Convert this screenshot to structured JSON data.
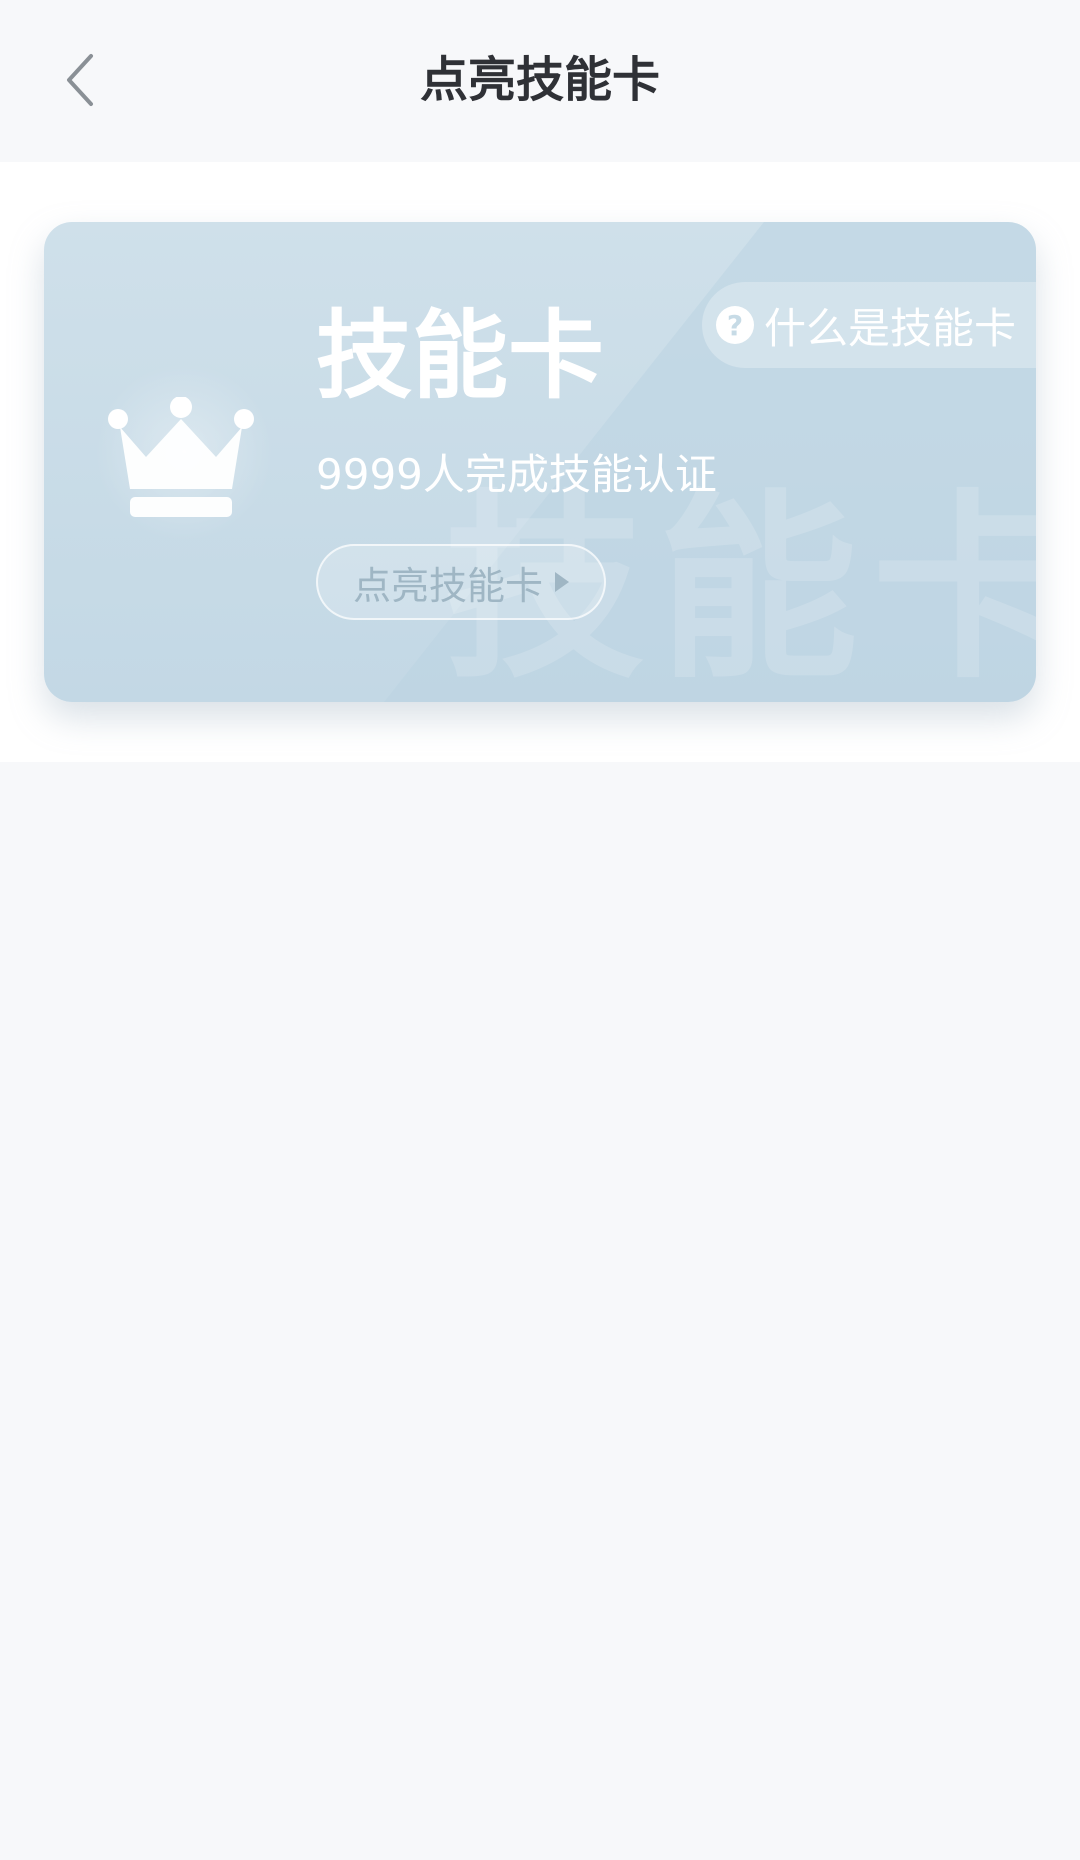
{
  "header": {
    "title": "点亮技能卡"
  },
  "card": {
    "title": "技能卡",
    "subtitle": "9999人完成技能认证",
    "watermark": "技能卡",
    "light_button_label": "点亮技能卡",
    "help_label": "什么是技能卡",
    "help_icon_glyph": "?"
  },
  "icons": {
    "back": "chevron-left-icon",
    "crown": "crown-icon",
    "help": "question-circle-icon",
    "play": "triangle-right-icon"
  },
  "colors": {
    "page_background": "#f7f8fa",
    "card_gradient_top": "#cfe0ea",
    "card_gradient_bottom": "#c3d8e5",
    "title_text": "#2f3136",
    "button_text": "#9fb6c4"
  }
}
